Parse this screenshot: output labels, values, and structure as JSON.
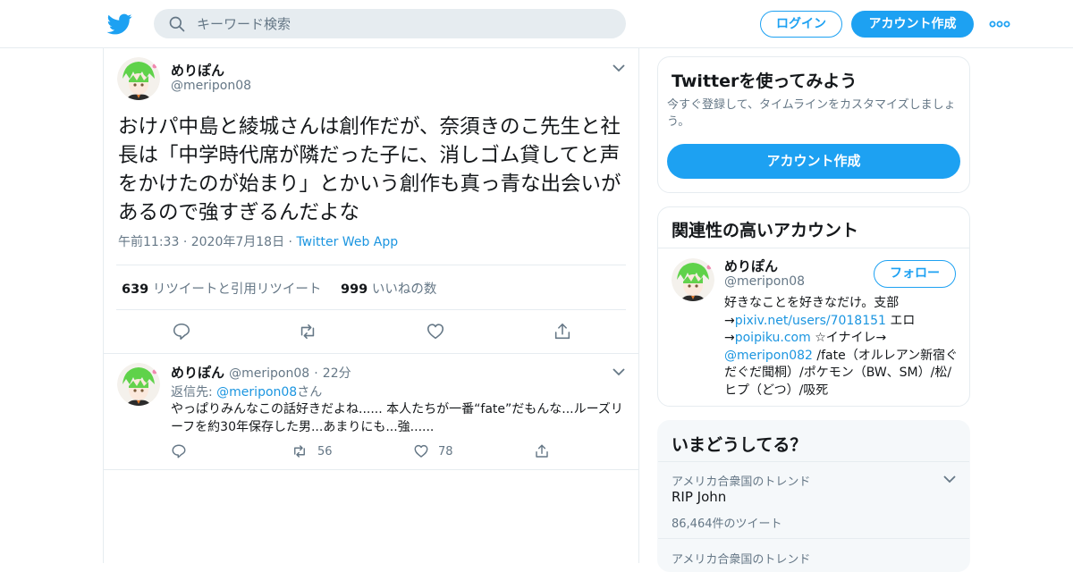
{
  "header": {
    "search_placeholder": "キーワード検索",
    "login_label": "ログイン",
    "signup_label": "アカウント作成"
  },
  "tweet": {
    "author_name": "めりぽん",
    "author_handle": "@meripon08",
    "text": "おけパ中島と綾城さんは創作だが、奈須きのこ先生と社長は「中学時代席が隣だった子に、消しゴム貸してと声をかけたのが始まり」とかいう創作も真っ青な出会いがあるので強すぎるんだよな",
    "time": "午前11:33",
    "date": "2020年7月18日",
    "source": "Twitter Web App",
    "retweets": "639",
    "retweets_label": "リツイートと引用リツイート",
    "likes": "999",
    "likes_label": "いいねの数"
  },
  "reply": {
    "author_name": "めりぽん",
    "author_handle": "@meripon08",
    "age": "22分",
    "reply_prefix": "返信先: ",
    "reply_to": "@meripon08",
    "reply_suffix": "さん",
    "text": "やっぱりみんなこの話好きだよね...... 本人たちが一番“fate”だもんな...ルーズリーフを約30年保存した男...あまりにも...強......",
    "retweet_count": "56",
    "like_count": "78"
  },
  "sidebar": {
    "signup_card": {
      "title": "Twitterを使ってみよう",
      "description": "今すぐ登録して、タイムラインをカスタマイズしましょう。",
      "button": "アカウント作成"
    },
    "related": {
      "title": "関連性の高いアカウント",
      "name": "めりぽん",
      "handle": "@meripon08",
      "follow_label": "フォロー",
      "bio_1": "好きなことを好きなだけ。支部",
      "bio_arrow": "→",
      "bio_link1": "pixiv.net/users/7018151",
      "bio_2": " エロ",
      "bio_link2": "poipiku.com",
      "bio_3": " ☆イナイレ→",
      "bio_link3": "@meripon082",
      "bio_4": " /fate（オルレアン新宿ぐだぐだ聞桐）/ポケモン（BW、SM）/松/ヒプ（どつ）/吸死"
    },
    "trends": {
      "title": "いまどうしてる？",
      "items": [
        {
          "context": "アメリカ合衆国のトレンド",
          "name": "RIP John",
          "count": "86,464件のツイート"
        },
        {
          "context": "アメリカ合衆国のトレンド"
        }
      ]
    }
  },
  "colors": {
    "accent": "#1da1f2",
    "link": "#1b95e0",
    "secondary_text": "#657786",
    "border": "#e6ecf0"
  },
  "icons": [
    "twitter-bird-icon",
    "search-icon",
    "more-dots-icon",
    "chevron-down-icon",
    "reply-icon",
    "retweet-icon",
    "like-icon",
    "share-icon"
  ]
}
